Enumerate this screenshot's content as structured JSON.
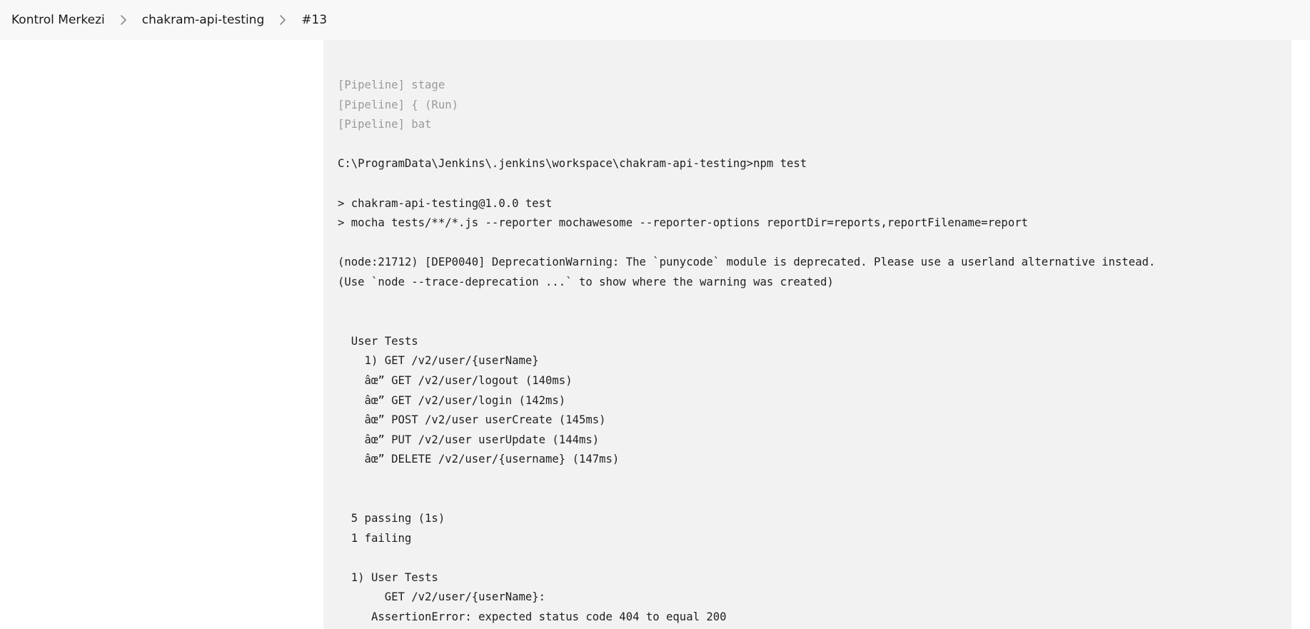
{
  "breadcrumb": {
    "items": [
      {
        "label": "Kontrol Merkezi"
      },
      {
        "label": "chakram-api-testing"
      },
      {
        "label": "#13"
      }
    ]
  },
  "console": {
    "lines": [
      {
        "text": "[Pipeline] stage",
        "kind": "pipeline"
      },
      {
        "text": "[Pipeline] { (Run)",
        "kind": "pipeline"
      },
      {
        "text": "[Pipeline] bat",
        "kind": "pipeline"
      },
      {
        "text": "",
        "kind": "normal"
      },
      {
        "text": "C:\\ProgramData\\Jenkins\\.jenkins\\workspace\\chakram-api-testing>npm test",
        "kind": "normal"
      },
      {
        "text": "",
        "kind": "normal"
      },
      {
        "text": "> chakram-api-testing@1.0.0 test",
        "kind": "normal"
      },
      {
        "text": "> mocha tests/**/*.js --reporter mochawesome --reporter-options reportDir=reports,reportFilename=report",
        "kind": "normal"
      },
      {
        "text": "",
        "kind": "normal"
      },
      {
        "text": "(node:21712) [DEP0040] DeprecationWarning: The `punycode` module is deprecated. Please use a userland alternative instead.",
        "kind": "normal"
      },
      {
        "text": "(Use `node --trace-deprecation ...` to show where the warning was created)",
        "kind": "normal"
      },
      {
        "text": "",
        "kind": "normal"
      },
      {
        "text": "",
        "kind": "normal"
      },
      {
        "text": "  User Tests",
        "kind": "normal"
      },
      {
        "text": "    1) GET /v2/user/{userName}",
        "kind": "normal"
      },
      {
        "text": "    âœ” GET /v2/user/logout (140ms)",
        "kind": "normal"
      },
      {
        "text": "    âœ” GET /v2/user/login (142ms)",
        "kind": "normal"
      },
      {
        "text": "    âœ” POST /v2/user userCreate (145ms)",
        "kind": "normal"
      },
      {
        "text": "    âœ” PUT /v2/user userUpdate (144ms)",
        "kind": "normal"
      },
      {
        "text": "    âœ” DELETE /v2/user/{username} (147ms)",
        "kind": "normal"
      },
      {
        "text": "",
        "kind": "normal"
      },
      {
        "text": "",
        "kind": "normal"
      },
      {
        "text": "  5 passing (1s)",
        "kind": "normal"
      },
      {
        "text": "  1 failing",
        "kind": "normal"
      },
      {
        "text": "",
        "kind": "normal"
      },
      {
        "text": "  1) User Tests",
        "kind": "normal"
      },
      {
        "text": "       GET /v2/user/{userName}:",
        "kind": "normal"
      },
      {
        "text": "     AssertionError: expected status code 404 to equal 200",
        "kind": "normal"
      }
    ]
  }
}
